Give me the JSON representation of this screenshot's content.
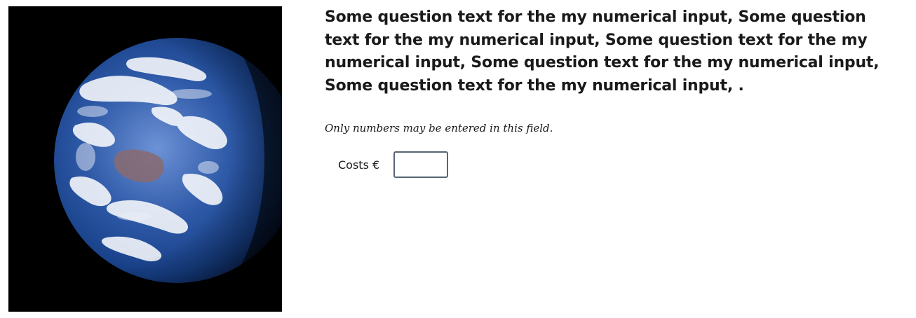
{
  "question": {
    "text": "Some question text for the my numerical input, Some question text for the my numerical input, Some question text for the my numerical input, Some question text for the my numerical input, Some question text for the my numerical input, ."
  },
  "hint": {
    "text": "Only numbers may be entered in this field."
  },
  "field": {
    "label": "Costs €",
    "value": "",
    "placeholder": ""
  },
  "image": {
    "subject": "earth-globe"
  },
  "colors": {
    "text": "#1a1a1a",
    "input_border": "#596574",
    "image_background": "#000000"
  }
}
